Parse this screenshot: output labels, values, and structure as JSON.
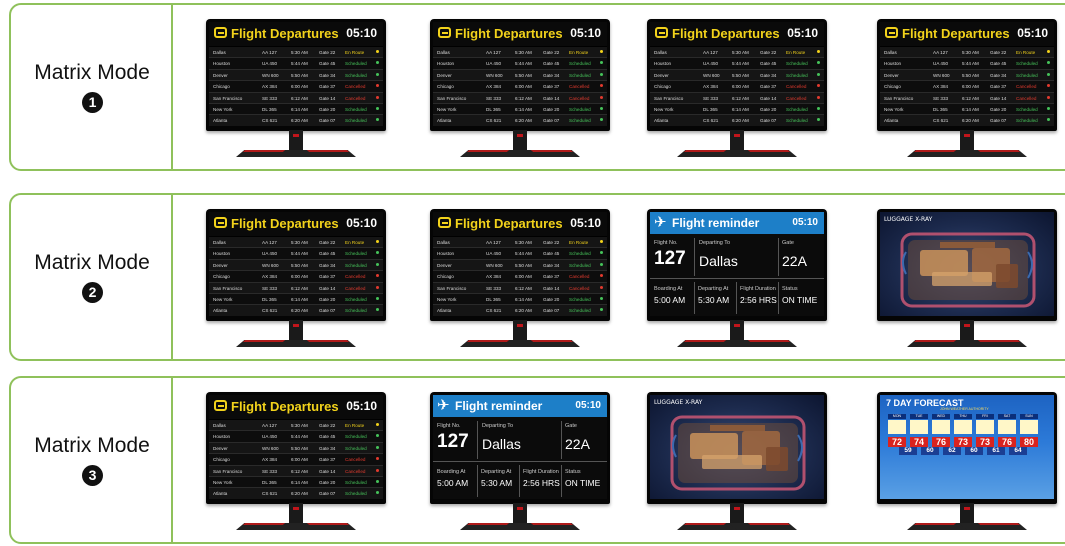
{
  "modes": [
    {
      "label": "Matrix Mode",
      "number": "1",
      "screens": [
        "departures",
        "departures",
        "departures",
        "departures"
      ]
    },
    {
      "label": "Matrix Mode",
      "number": "2",
      "screens": [
        "departures",
        "departures",
        "reminder",
        "xray"
      ]
    },
    {
      "label": "Matrix Mode",
      "number": "3",
      "screens": [
        "departures",
        "reminder",
        "xray",
        "weather"
      ]
    }
  ],
  "departures": {
    "title": "Flight Departures",
    "time": "05:10",
    "rows": [
      {
        "city": "Dallas",
        "flight": "AA 127",
        "time": "5:30 AM",
        "gate": "Gate 22",
        "status": "En Route",
        "color": "#f2d21b"
      },
      {
        "city": "Houston",
        "flight": "UA 450",
        "time": "5:44 AM",
        "gate": "Gate 45",
        "status": "Scheduled",
        "color": "#46c35a"
      },
      {
        "city": "Denver",
        "flight": "WN 600",
        "time": "5:50 AM",
        "gate": "Gate 34",
        "status": "Scheduled",
        "color": "#46c35a"
      },
      {
        "city": "Chicago",
        "flight": "AX 384",
        "time": "6:00 AM",
        "gate": "Gate 37",
        "status": "Cancelled",
        "color": "#e23a2e"
      },
      {
        "city": "San Francisco",
        "flight": "SE 333",
        "time": "6:12 AM",
        "gate": "Gate 14",
        "status": "Cancelled",
        "color": "#e23a2e"
      },
      {
        "city": "New York",
        "flight": "DL 365",
        "time": "6:14 AM",
        "gate": "Gate 20",
        "status": "Scheduled",
        "color": "#46c35a"
      },
      {
        "city": "Atlanta",
        "flight": "CS 621",
        "time": "6:20 AM",
        "gate": "Gate 07",
        "status": "Scheduled",
        "color": "#46c35a"
      }
    ]
  },
  "reminder": {
    "title": "Flight reminder",
    "time": "05:10",
    "flight_no_label": "Flight No.",
    "flight_no": "127",
    "departing_to_label": "Departing To",
    "departing_to": "Dallas",
    "gate_label": "Gate",
    "gate": "22A",
    "boarding_label": "Boarding At",
    "boarding": "5:00 AM",
    "departing_at_label": "Departing At",
    "departing_at": "5:30 AM",
    "duration_label": "Flight Duration",
    "duration": "2:56 HRS",
    "status_label": "Status",
    "status": "ON TIME"
  },
  "xray": {
    "title": "LUGGAGE X-RAY"
  },
  "weather": {
    "title": "7 DAY FORECAST",
    "subtitle": "JOHN WEATHER AUTHORITY",
    "days": [
      "MON",
      "TUE",
      "WED",
      "THU",
      "FRI",
      "SAT",
      "SUN"
    ],
    "highs": [
      "72",
      "74",
      "76",
      "73",
      "73",
      "76",
      "80"
    ],
    "lows": [
      "59",
      "60",
      "62",
      "60",
      "61",
      "64",
      ""
    ]
  },
  "colors": {
    "accent_border": "#8fc15b",
    "reminder_blue": "#1d7fc8",
    "departures_yellow": "#f2d21b"
  }
}
